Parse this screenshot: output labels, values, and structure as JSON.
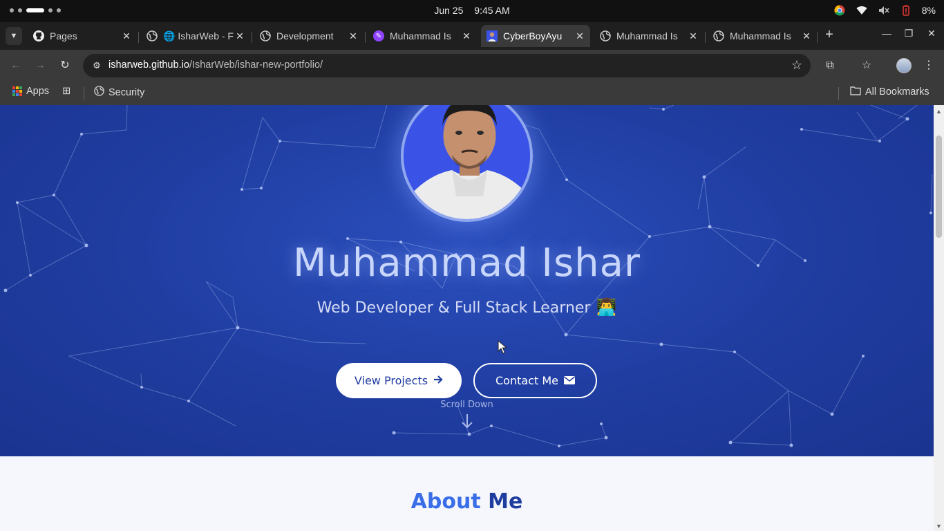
{
  "os": {
    "date": "Jun 25",
    "time": "9:45 AM",
    "battery": "8%"
  },
  "tabs": [
    {
      "title": "Pages",
      "favicon": "github-icon"
    },
    {
      "title": "🌐 IsharWeb - F",
      "favicon": "globe-icon"
    },
    {
      "title": "Development",
      "favicon": "globe-icon"
    },
    {
      "title": "Muhammad Is",
      "favicon": "purple-app-icon"
    },
    {
      "title": "CyberBoyAyu",
      "favicon": "profile-photo-icon"
    },
    {
      "title": "Muhammad Is",
      "favicon": "globe-icon"
    },
    {
      "title": "Muhammad Is",
      "favicon": "globe-icon"
    }
  ],
  "active_tab": "CyberBoyAyu",
  "toolbar": {
    "url_host": "isharweb.github.io",
    "url_path": "/IsharWeb/ishar-new-portfolio/"
  },
  "bookmarks": {
    "apps": "Apps",
    "security": "Security",
    "all": "All Bookmarks"
  },
  "hero": {
    "name": "Muhammad Ishar",
    "subtitle": "Web Developer & Full Stack Learner",
    "emoji": "👨‍💻",
    "view_projects": "View Projects",
    "contact_me": "Contact Me",
    "scroll_down": "Scroll Down"
  },
  "about": {
    "title_part1": "About",
    "title_part2": "Me"
  },
  "colors": {
    "hero_bg": "#1f3c9f",
    "accent_light": "#3a6ee8",
    "accent_dark": "#1f3c9f",
    "chrome_dark": "#1f1f1f",
    "chrome_toolbar": "#3a3a3a"
  }
}
